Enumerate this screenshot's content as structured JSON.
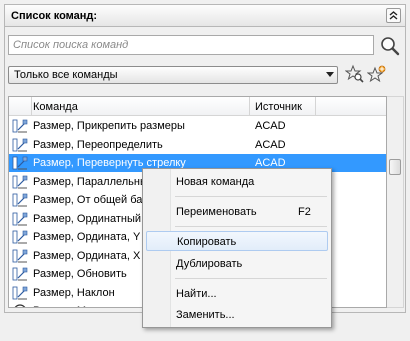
{
  "panel": {
    "title": "Список команд:",
    "collapse_icon": "double-chevron-up-icon"
  },
  "search": {
    "placeholder": "Список поиска команд",
    "value": "",
    "icon": "search-icon"
  },
  "filter": {
    "selected": "Только все команды",
    "icons": [
      "star-search-icon",
      "new-command-star-icon"
    ]
  },
  "list": {
    "columns": [
      "Команда",
      "Источник"
    ],
    "rows": [
      {
        "name": "Размер, Прикрепить размеры",
        "source": "ACAD",
        "selected": false
      },
      {
        "name": "Размер, Переопределить",
        "source": "ACAD",
        "selected": false
      },
      {
        "name": "Размер, Перевернуть стрелку",
        "source": "ACAD",
        "selected": true
      },
      {
        "name": "Размер, Параллельный",
        "source": "",
        "selected": false
      },
      {
        "name": "Размер, От общей ба",
        "source": "",
        "selected": false
      },
      {
        "name": "Размер, Ординатный",
        "source": "",
        "selected": false
      },
      {
        "name": "Размер, Ордината, Y",
        "source": "",
        "selected": false
      },
      {
        "name": "Размер, Ордината, X",
        "source": "",
        "selected": false
      },
      {
        "name": "Размер, Обновить",
        "source": "",
        "selected": false
      },
      {
        "name": "Размер, Наклон",
        "source": "",
        "selected": false
      },
      {
        "name": "Размер, Маркер цент",
        "source": "",
        "selected": false
      }
    ]
  },
  "context_menu": {
    "items": [
      {
        "label": "Новая команда",
        "shortcut": ""
      },
      {
        "label": "Переименовать",
        "shortcut": "F2"
      },
      {
        "label": "Копировать",
        "shortcut": "",
        "highlighted": true
      },
      {
        "label": "Дублировать",
        "shortcut": ""
      },
      {
        "label": "Найти...",
        "shortcut": ""
      },
      {
        "label": "Заменить...",
        "shortcut": ""
      }
    ]
  },
  "colors": {
    "selection": "#3399ff",
    "menu_highlight_border": "#aecbf0"
  }
}
